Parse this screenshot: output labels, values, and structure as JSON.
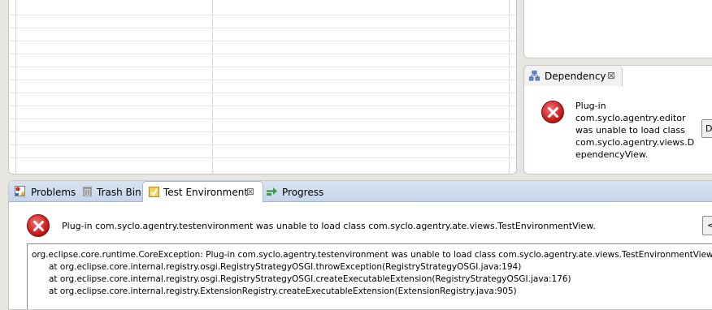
{
  "dependency_view": {
    "tab_label": "Dependency",
    "error_lines": [
      "Plug-in",
      "com.syclo.agentry.editor",
      "was unable to load class",
      "com.syclo.agentry.views.D",
      "ependencyView."
    ],
    "details_button_label": "D"
  },
  "bottom_tabs": [
    {
      "label": "Problems"
    },
    {
      "label": "Trash Bin"
    },
    {
      "label": "Test Environment"
    },
    {
      "label": "Progress"
    }
  ],
  "test_environment": {
    "error_message": "Plug-in com.syclo.agentry.testenvironment was unable to load class com.syclo.agentry.ate.views.TestEnvironmentView.",
    "details_button_label": "<",
    "stack_trace": [
      "org.eclipse.core.runtime.CoreException: Plug-in com.syclo.agentry.testenvironment was unable to load class com.syclo.agentry.ate.views.TestEnvironmentView",
      "at org.eclipse.core.internal.registry.osgi.RegistryStrategyOSGI.throwException(RegistryStrategyOSGI.java:194)",
      "at org.eclipse.core.internal.registry.osgi.RegistryStrategyOSGI.createExecutableExtension(RegistryStrategyOSGI.java:176)",
      "at org.eclipse.core.internal.registry.ExtensionRegistry.createExecutableExtension(ExtensionRegistry.java:905)"
    ]
  },
  "close_glyph": "⊠"
}
